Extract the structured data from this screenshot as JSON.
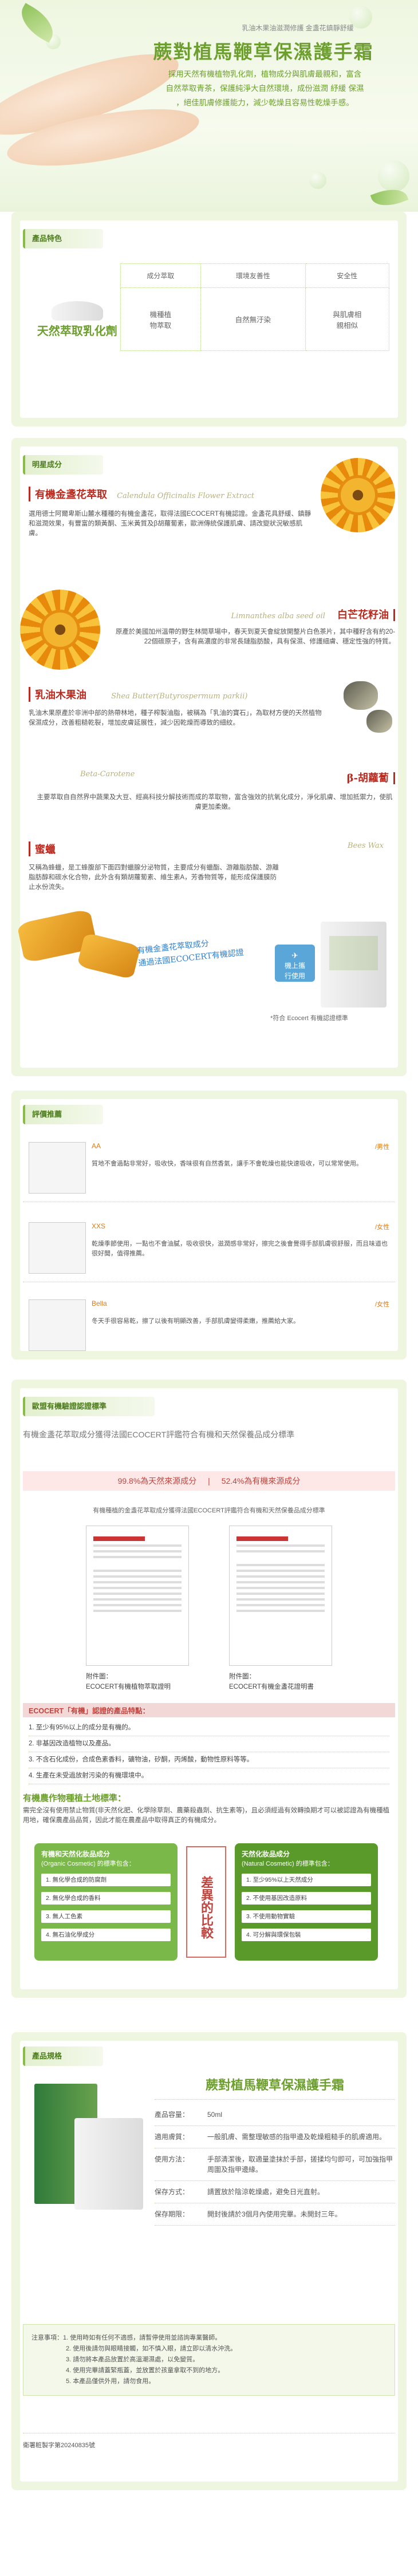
{
  "hero": {
    "tagline": "乳油木果油滋潤修護 金盞花鎮靜舒緩",
    "title": "蕨對植馬鞭草保濕護手霜",
    "desc": [
      "採用天然有機植物乳化劑，植物成分與肌膚最親和，富含",
      "自然萃取青茶，保護純淨大自然環境，成份滋潤 紓緩 保濕",
      "，絕佳肌膚修護能力，減少乾燥且容易性乾燥手感。"
    ]
  },
  "features": {
    "section_title": "產品特色",
    "headers": [
      "成分萃取",
      "環境友善性",
      "安全性"
    ],
    "left_title": "天然萃取乳化劑",
    "cells": [
      "機種植\n物萃取",
      "自然無汙染",
      "與肌膚相\n親相似"
    ]
  },
  "ingredients": {
    "section_title": "明星成分",
    "items": [
      {
        "name": "有機金盞花萃取",
        "latin": "Calendula Officinalis Flower Extract",
        "text": "選用德士阿爾卑斯山麓水種種的有機金盞花，取得法國ECOCERT有機認證。金盞花具舒緩、鎮靜和滋潤效果，有豐富的類黃酮、玉米黃質及β胡蘿蔔素，歐洲傳統保護肌膚、請改變狀況敏感肌膚。"
      },
      {
        "name": "白芒花籽油",
        "latin": "Limnanthes alba seed oil",
        "text": "原產於美國加州溫帶的野生林間草場中，春天到夏天會綻放開整片白色茶片，其中種籽含有約20-22個碳原子，含有高濃度的非常長鏈脂肪酸，具有保濕、修護細膚、穩定性強的特質。"
      },
      {
        "name": "乳油木果油",
        "latin": "Shea Butter(Butyrospermum parkii)",
        "text": "乳油木果原產於非洲中部的熱帶林地，種子榨製油脂，被稱為「乳油的寶石」，為取材方便的天然植物保濕成分，改善粗糙乾裂，增加皮膚延展性，減少因乾燥而導致的細紋。"
      },
      {
        "name": "β-胡蘿蔔",
        "latin": "Beta-Carotene",
        "text": "主要萃取自自然界中蔬果及大豆、經高科技分解技術而成的萃取物，富含強效的抗氧化成分，淨化肌膚、增加抵禦力，使肌膚更加柔嫩。"
      },
      {
        "name": "蜜蠟",
        "latin": "Bees Wax",
        "text": "又稱為蜂蠟，是工蜂腹部下面四對蠟腺分泌物質，主要成分有蠟酯、游離脂肪酸、游離脂肪醇和碳水化合物，此外含有類胡蘿蔔素、維生素A，芳香物質等，能形成保護膜防止水份流失。"
      }
    ],
    "badge_title": "有機金盞花萃取成分",
    "badge_sub": "通過法國ECOCERT有機認證",
    "cert_note": "*符合 Ecocert 有機認證標準",
    "package_line1": "機上攜",
    "package_line2": "行使用"
  },
  "reviews": {
    "section_title": "評價推薦",
    "items": [
      {
        "name": "AA",
        "tag": "/男性",
        "text": "質地不會過黏非常好，吸收快，香味很有自然香氣，讓手不會乾燥也能快速吸收，可以常常使用。"
      },
      {
        "name": "XXS",
        "tag": "/女性",
        "text": "乾燥季節使用，一點也不會油膩，吸收很快，滋潤感非常好，擦完之後會覺得手部肌膚很舒服，而且味道也很好聞，值得推薦。"
      },
      {
        "name": "Bella",
        "tag": "/女性",
        "text": "冬天手很容易乾，擦了以後有明顯改善，手部肌膚變得柔嫩，推薦給大家。"
      }
    ]
  },
  "cert": {
    "section_title": "歐盟有機驗證認證標準",
    "intro": "有機金盞花萃取成分獲得法國ECOCERT評鑑符合有機和天然保養品成分標準",
    "pct1": "99.8%為天然來源成分",
    "pct2": "52.4%為有機來源成分",
    "sub": "有機種植的金盞花萃取成分獲得法國ECOCERT評鑑符合有機和天然保養品成分標準",
    "doc1_title": "附件圖：",
    "doc1_sub": "ECOCERT有機植物萃取證明",
    "doc2_title": "附件圖：",
    "doc2_sub": "ECOCERT有機金盞花證明書",
    "benefit_title": "ECOCERT「有機」認證的產品特點：",
    "benefits": [
      "1. 至少有95%以上的成分是有機的。",
      "2. 非基因改造植物以及產品。",
      "3. 不含石化成份，合成色素香料，礦物油，矽酮，丙烯酸，動物性原料等等。",
      "4. 生產在未受過放射污染的有機環境中。"
    ],
    "farm_title": "有機農作物種植土地標準：",
    "farm_text": "需完全沒有使用禁止物質(非天然化肥、化學除草劑、農藥殺蟲劑、抗生素等)，且必須經過有效轉換期才可以被認證為有機種植用地，確保農產品品質，因此才能在農產品中取得真正的有機成分。",
    "left_col_title": "有機和天然化妝品成分",
    "left_col_sub": "(Organic Cosmetic) 的標準包含：",
    "left_items": [
      "1. 無化學合成的防腐劑",
      "2. 無化學合成的香料",
      "3. 無人工色素",
      "4. 無石油化學成分"
    ],
    "mid": "差異的比較",
    "right_col_title": "天然化妝品成分",
    "right_col_sub": "(Natural Cosmetic) 的標準包含：",
    "right_items": [
      "1. 至少95%以上天然成分",
      "2. 不使用基因改造原料",
      "3. 不使用動物實驗",
      "4. 可分解與環保包裝"
    ]
  },
  "spec": {
    "section_title": "產品規格",
    "product_title": "蕨對植馬鞭草保濕護手霜",
    "rows": [
      {
        "k": "產品容量：",
        "v": "50ml"
      },
      {
        "k": "適用膚質：",
        "v": "一般肌膚、需整理敏感的指甲邊及乾燥粗糙手的肌膚適用。"
      },
      {
        "k": "使用方法：",
        "v": "手部清潔後，取適量塗抹於手部，搓揉均勻即可，可加強指甲周圍及指甲邊緣。"
      },
      {
        "k": "保存方式：",
        "v": "請置放於陰涼乾燥處，避免日光直射。"
      },
      {
        "k": "保存期限：",
        "v": "開封後請於3個月內使用完畢。未開封三年。"
      }
    ],
    "notes": [
      "注意事項：1. 使用時如有任何不適感，請暫停使用並諮詢專業醫師。",
      "2. 使用後請勿與眼睛接觸，如不慎入眼，請立即以清水沖洗。",
      "3. 請勿將本產品放置於高溫潮濕處，以免變質。",
      "4. 使用完畢請蓋緊瓶蓋，並放置於孩童拿取不到的地方。",
      "5. 本產品僅供外用，請勿食用。"
    ],
    "footer": "衛署粧製字第20240835號"
  },
  "colors": {
    "green": "#6d9f2e",
    "red": "#bb2b1f",
    "pink_bar": "#fde8e7",
    "left_col": "#7bb84a",
    "right_col": "#5a9a2a"
  }
}
